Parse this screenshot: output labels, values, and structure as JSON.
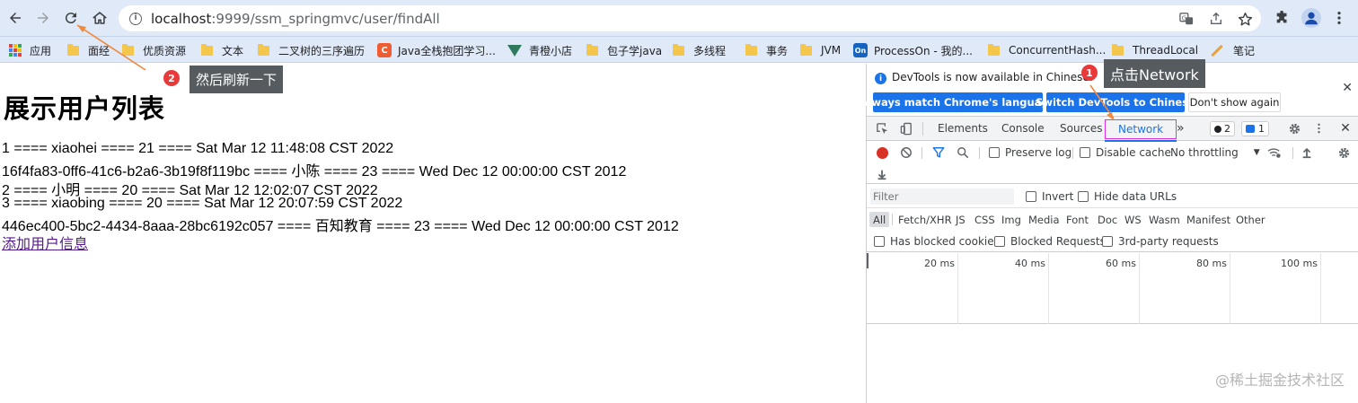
{
  "browser": {
    "url_host": "localhost",
    "url_path": ":9999/ssm_springmvc/user/findAll"
  },
  "bookmarks": [
    {
      "label": "应用",
      "icon": "apps-grid-icon"
    },
    {
      "label": "面经",
      "icon": "folder-icon"
    },
    {
      "label": "优质资源",
      "icon": "folder-icon"
    },
    {
      "label": "文本",
      "icon": "folder-icon"
    },
    {
      "label": "二叉树的三序遍历",
      "icon": "folder-icon"
    },
    {
      "label": "Java全栈抱团学习...",
      "icon": "csdn-icon"
    },
    {
      "label": "青橙小店",
      "icon": "vue-icon"
    },
    {
      "label": "包子学java",
      "icon": "folder-icon"
    },
    {
      "label": "多线程",
      "icon": "folder-icon"
    },
    {
      "label": "事务",
      "icon": "folder-icon"
    },
    {
      "label": "JVM",
      "icon": "folder-icon"
    },
    {
      "label": "ProcessOn - 我的...",
      "icon": "processon-icon"
    },
    {
      "label": "ConcurrentHash...",
      "icon": "folder-icon"
    },
    {
      "label": "ThreadLocal",
      "icon": "folder-icon"
    },
    {
      "label": "笔记",
      "icon": "pen-icon"
    }
  ],
  "page": {
    "title": "展示用户列表",
    "rows": [
      "1 ==== xiaohei ==== 21 ==== Sat Mar 12 11:48:08 CST 2022",
      "16f4fa83-0ff6-41c6-b2a6-3b19f8f119bc ==== 小陈 ==== 23 ==== Wed Dec 12 00:00:00 CST 2012",
      "2 ==== 小明 ==== 20 ==== Sat Mar 12 12:02:07 CST 2022",
      "3 ==== xiaobing ==== 20 ==== Sat Mar 12 20:07:59 CST 2022",
      "446ec400-5bc2-4434-8aaa-28bc6192c057 ==== 百知教育 ==== 23 ==== Wed Dec 12 00:00:00 CST 2012"
    ],
    "add_link": "添加用户信息"
  },
  "devtools": {
    "banner_text": "DevTools is now available in Chinese!",
    "btn_match": "Always match Chrome's language",
    "btn_switch": "Switch DevTools to Chinese",
    "btn_dismiss": "Don't show again",
    "tabs": {
      "elements": "Elements",
      "console": "Console",
      "sources": "Sources",
      "network": "Network",
      "more": "»"
    },
    "errors_count": "2",
    "messages_count": "1",
    "preserve_log": "Preserve log",
    "disable_cache": "Disable cache",
    "throttling": "No throttling",
    "filter_placeholder": "Filter",
    "invert": "Invert",
    "hide_data_urls": "Hide data URLs",
    "types": [
      "All",
      "Fetch/XHR",
      "JS",
      "CSS",
      "Img",
      "Media",
      "Font",
      "Doc",
      "WS",
      "Wasm",
      "Manifest",
      "Other"
    ],
    "has_blocked_cookies": "Has blocked cookies",
    "blocked_requests": "Blocked Requests",
    "third_party": "3rd-party requests",
    "timeline_ticks": [
      "20 ms",
      "40 ms",
      "60 ms",
      "80 ms",
      "100 ms"
    ]
  },
  "annotations": {
    "step1_num": "1",
    "step1_text": "点击Network",
    "step2_num": "2",
    "step2_text": "然后刷新一下",
    "arrow_color": "#f0883e"
  },
  "watermark": "@稀土掘金技术社区"
}
